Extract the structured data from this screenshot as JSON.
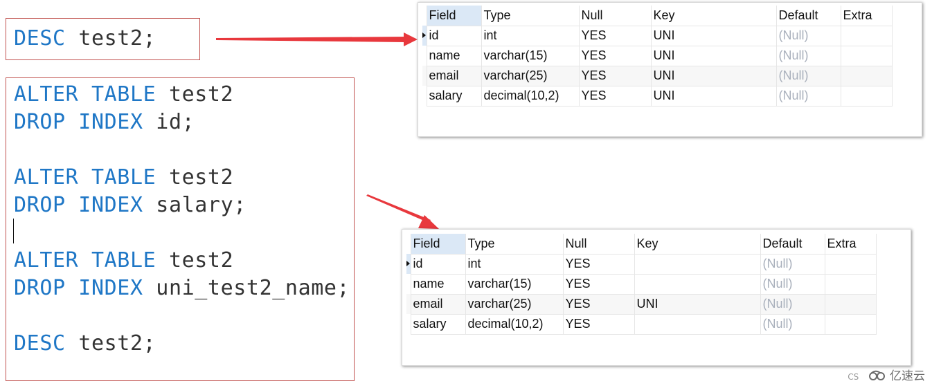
{
  "code_blocks": {
    "top": {
      "lines": [
        {
          "kw": "DESC",
          "rest": " test2;"
        }
      ]
    },
    "bottom": {
      "lines": [
        {
          "kw": "ALTER TABLE",
          "rest": " test2"
        },
        {
          "kw": "DROP INDEX",
          "rest": " id;"
        },
        {
          "kw": "",
          "rest": ""
        },
        {
          "kw": "ALTER TABLE",
          "rest": " test2"
        },
        {
          "kw": "DROP INDEX",
          "rest": " salary;"
        },
        {
          "kw": "",
          "rest": ""
        },
        {
          "kw": "ALTER TABLE",
          "rest": " test2"
        },
        {
          "kw": "DROP INDEX",
          "rest": " uni_test2_name;"
        },
        {
          "kw": "",
          "rest": ""
        },
        {
          "kw": "DESC",
          "rest": " test2;"
        }
      ]
    }
  },
  "colors": {
    "keyword": "#1f77c6",
    "identifier": "#333333",
    "box_border": "#c0504d",
    "arrow": "#e8383d",
    "null_value": "#a9b0bc",
    "selected_header": "#dbe8f6"
  },
  "result_before": {
    "columns": [
      "Field",
      "Type",
      "Null",
      "Key",
      "Default",
      "Extra"
    ],
    "rows": [
      [
        "id",
        "int",
        "YES",
        "UNI",
        "(Null)",
        ""
      ],
      [
        "name",
        "varchar(15)",
        "YES",
        "UNI",
        "(Null)",
        ""
      ],
      [
        "email",
        "varchar(25)",
        "YES",
        "UNI",
        "(Null)",
        ""
      ],
      [
        "salary",
        "decimal(10,2)",
        "YES",
        "UNI",
        "(Null)",
        ""
      ]
    ]
  },
  "result_after": {
    "columns": [
      "Field",
      "Type",
      "Null",
      "Key",
      "Default",
      "Extra"
    ],
    "rows": [
      [
        "id",
        "int",
        "YES",
        "",
        "(Null)",
        ""
      ],
      [
        "name",
        "varchar(15)",
        "YES",
        "",
        "(Null)",
        ""
      ],
      [
        "email",
        "varchar(25)",
        "YES",
        "UNI",
        "(Null)",
        ""
      ],
      [
        "salary",
        "decimal(10,2)",
        "YES",
        "",
        "(Null)",
        ""
      ]
    ]
  },
  "watermark": {
    "prefix": "CS",
    "logo_icon": "cloud-logo-icon",
    "text": "亿速云"
  }
}
